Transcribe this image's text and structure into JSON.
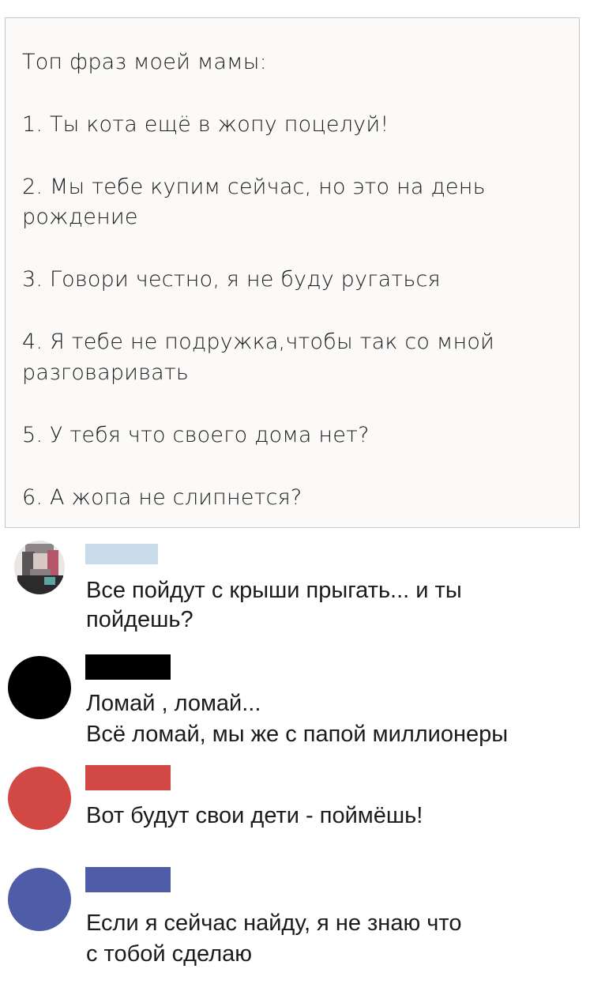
{
  "post": {
    "title": "Топ фраз моей мамы:",
    "items": [
      {
        "line1": "1. Ты кота ещё в жопу поцелуй!",
        "line2": ""
      },
      {
        "line1": "2. Мы тебе купим сейчас, но это на день",
        "line2": "рождение"
      },
      {
        "line1": "3. Говори честно, я не буду ругаться",
        "line2": ""
      },
      {
        "line1": "4. Я тебе не подружка,чтобы так со мной",
        "line2": "разговаривать"
      },
      {
        "line1": "5. У тебя что своего дома нет?",
        "line2": ""
      },
      {
        "line1": "6. А жопа не слипнется?",
        "line2": ""
      }
    ]
  },
  "comments": [
    {
      "avatar": "pixelated-photo",
      "name_color": "#c7dbe8",
      "line1": "Все пойдут с крыши прыгать... и ты",
      "line2": "пойдешь?"
    },
    {
      "avatar_color": "#000000",
      "name_color": "#000000",
      "line1": "Ломай , ломай...",
      "line2": "Всё ломай, мы же с папой миллионеры"
    },
    {
      "avatar_color": "#d24844",
      "name_color": "#d24844",
      "line1": "Вот будут свои дети - поймёшь!",
      "line2": ""
    },
    {
      "avatar_color": "#4f5ca8",
      "name_color": "#4f5ca8",
      "line1": "Если я сейчас найду, я не знаю что",
      "line2": "с тобой сделаю"
    }
  ]
}
